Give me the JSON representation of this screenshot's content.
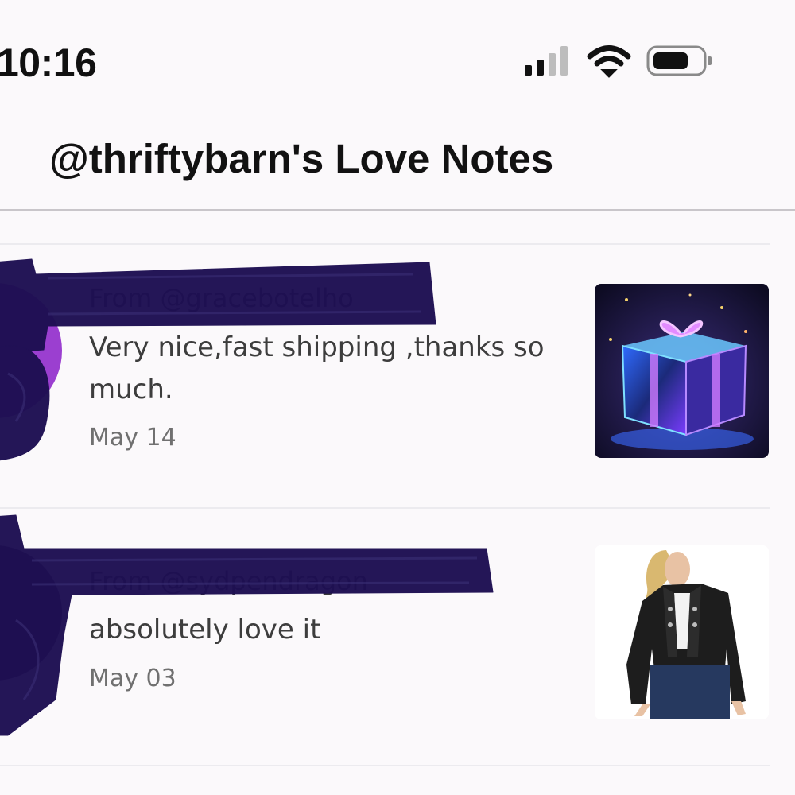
{
  "status_bar": {
    "time": "10:16",
    "icons": [
      "cellular-signal-icon",
      "wifi-icon",
      "battery-icon"
    ]
  },
  "header": {
    "title": "@thriftybarn's Love Notes"
  },
  "notes": [
    {
      "from": "From @gracebotelho",
      "message": "Very nice,fast shipping ,thanks so much.",
      "date": "May 14",
      "thumbnail": "gift-box-image"
    },
    {
      "from": "From @sydpendragon",
      "message": "absolutely love it",
      "date": "May 03",
      "thumbnail": "leather-jacket-image"
    }
  ],
  "colors": {
    "background": "#fbf9fb",
    "redaction": "#1e0f52",
    "avatar_accent": "#9b3fd0"
  }
}
